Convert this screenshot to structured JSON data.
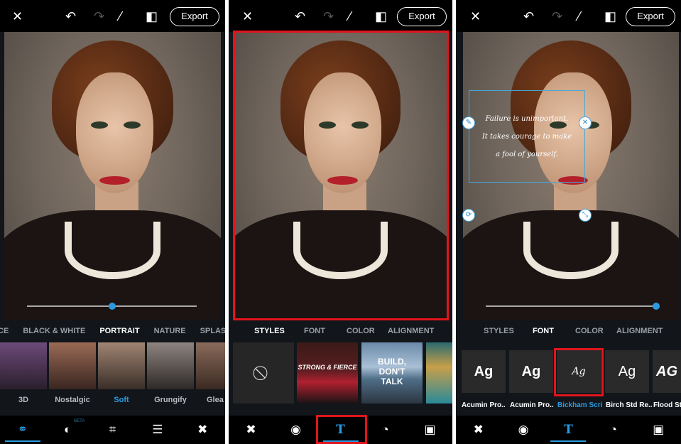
{
  "common": {
    "export_label": "Export",
    "icons": [
      "close-icon",
      "undo-icon",
      "redo-icon",
      "magic-wand-icon",
      "compare-icon"
    ]
  },
  "panel1": {
    "categories": [
      "ICE",
      "BLACK & WHITE",
      "PORTRAIT",
      "NATURE",
      "SPLASH"
    ],
    "active_category": "PORTRAIT",
    "filters": [
      "3D",
      "Nostalgic",
      "Soft",
      "Grungify",
      "Glea"
    ],
    "active_filter": "Soft",
    "slider_value": 0.5,
    "nav": [
      "looks-icon",
      "overlay-icon",
      "crop-icon",
      "adjust-icon",
      "healing-icon"
    ],
    "beta_label": "BETA"
  },
  "panel2": {
    "tabs": [
      "STYLES",
      "FONT",
      "COLOR",
      "ALIGNMENT"
    ],
    "active_tab": "STYLES",
    "styles": [
      "none",
      "STRONG & FIERCE",
      "BUILD, DON'T TALK",
      ""
    ],
    "nav": [
      "healing-icon",
      "eye-icon",
      "text-icon",
      "sticker-icon",
      "frame-icon"
    ]
  },
  "panel3": {
    "tabs": [
      "STYLES",
      "FONT",
      "COLOR",
      "ALIGNMENT"
    ],
    "active_tab": "FONT",
    "fonts": [
      {
        "sample": "Ag",
        "label": "Acumin Pro.."
      },
      {
        "sample": "Ag",
        "label": "Acumin Pro.."
      },
      {
        "sample": "Ag",
        "label": "Bickham Scri"
      },
      {
        "sample": "Ag",
        "label": "Birch Std Re.."
      },
      {
        "sample": "AG",
        "label": "Flood Std"
      }
    ],
    "quote": [
      "Failure is unimportant.",
      "It takes courage to make",
      "a fool of yourself."
    ],
    "slider_value": 1.0
  },
  "colors": {
    "accent": "#2b9be0",
    "highlight": "#e2141c"
  }
}
